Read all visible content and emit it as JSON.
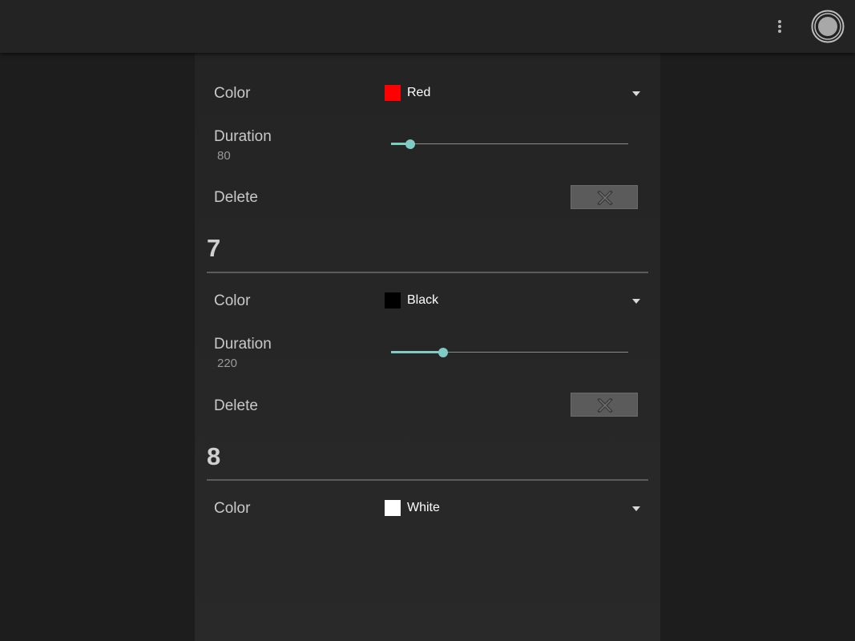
{
  "toolbar": {
    "overflow_icon": "more-vert-icon",
    "record_icon": "record-icon"
  },
  "colors": {
    "accent": "#80cbc4",
    "swatch_red": "#ff0000",
    "swatch_black": "#000000",
    "swatch_white": "#ffffff"
  },
  "entries": [
    {
      "color_label": "Color",
      "color_value": "Red",
      "duration_label": "Duration",
      "duration_value": "80",
      "duration_fraction": 0.08,
      "delete_label": "Delete"
    },
    {
      "number": "7",
      "color_label": "Color",
      "color_value": "Black",
      "duration_label": "Duration",
      "duration_value": "220",
      "duration_fraction": 0.22,
      "delete_label": "Delete"
    },
    {
      "number": "8",
      "color_label": "Color",
      "color_value": "White"
    }
  ]
}
